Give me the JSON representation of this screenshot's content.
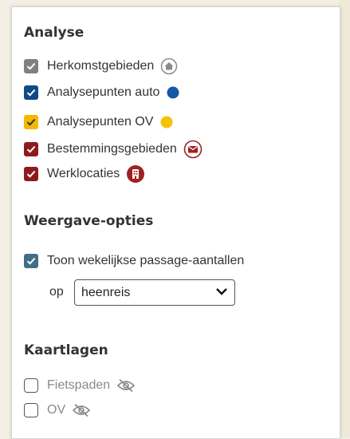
{
  "colors": {
    "gray": "#808080",
    "blue": "#0e4a86",
    "yellow": "#f5b800",
    "red": "#8e1b1b",
    "teal": "#3f6f86",
    "blue_dot": "#1559a6",
    "yellow_dot": "#f5c400",
    "red_icon": "#9e2222"
  },
  "analyse": {
    "title": "Analyse",
    "items": [
      {
        "label": "Herkomstgebieden",
        "checked": true,
        "icon": "home-icon"
      },
      {
        "label": "Analysepunten auto",
        "checked": true,
        "icon": "blue-dot-icon"
      },
      {
        "label": "Analysepunten OV",
        "checked": true,
        "icon": "yellow-dot-icon"
      },
      {
        "label": "Bestemmingsgebieden",
        "checked": true,
        "icon": "mail-icon"
      },
      {
        "label": "Werklocaties",
        "checked": true,
        "icon": "building-icon"
      }
    ]
  },
  "weergave": {
    "title": "Weergave-opties",
    "toggle_label": "Toon wekelijkse passage-aantallen",
    "toggle_checked": true,
    "op_label": "op",
    "select_value": "heenreis"
  },
  "kaartlagen": {
    "title": "Kaartlagen",
    "items": [
      {
        "label": "Fietspaden",
        "checked": false,
        "icon": "eye-off-icon"
      },
      {
        "label": "OV",
        "checked": false,
        "icon": "eye-off-icon"
      }
    ]
  }
}
